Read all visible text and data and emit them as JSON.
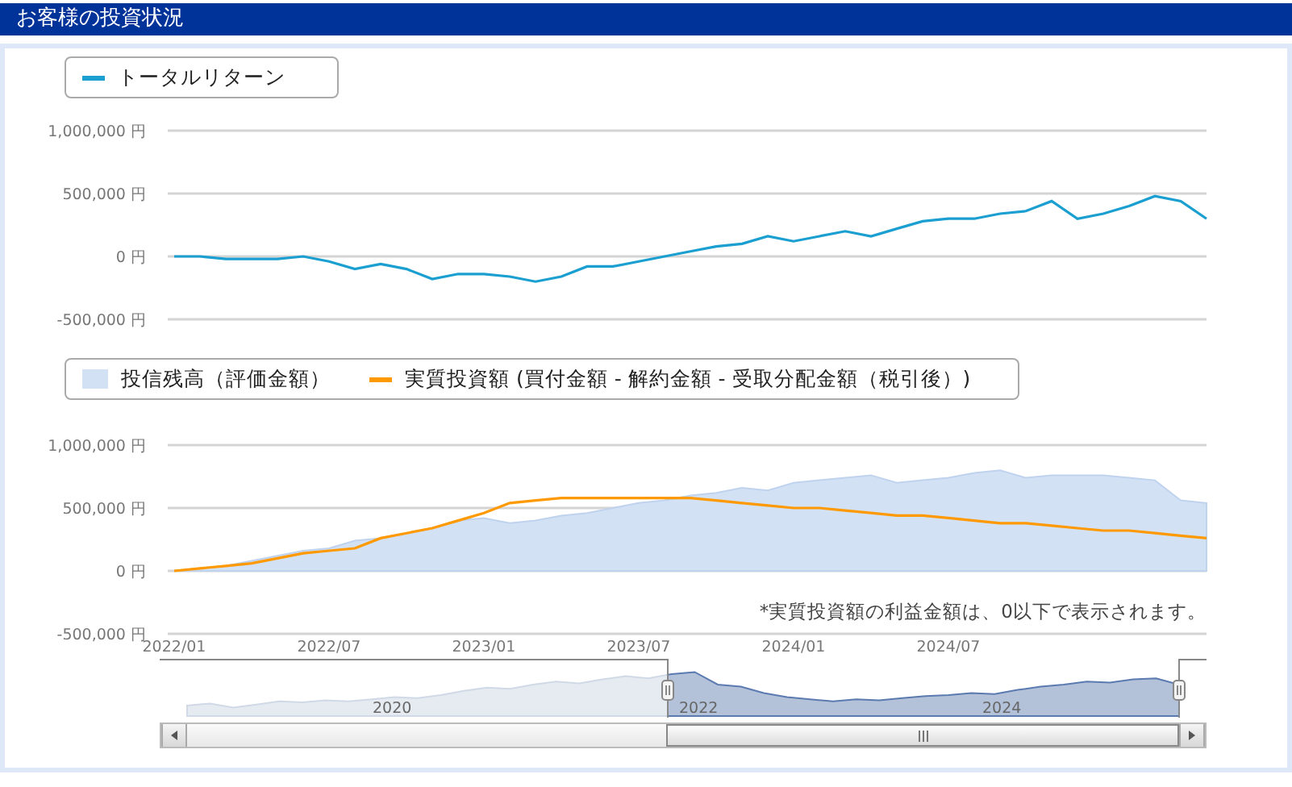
{
  "header": {
    "title": "お客様の投資状況"
  },
  "return_chart": {
    "chart_data": {
      "type": "line",
      "ylim": [
        -500000,
        1000000
      ],
      "yticks": [
        {
          "value": 1000000,
          "label": "1,000,000 円"
        },
        {
          "value": 500000,
          "label": "500,000 円"
        },
        {
          "value": 0,
          "label": "0 円"
        },
        {
          "value": -500000,
          "label": "-500,000 円"
        }
      ],
      "series": [
        {
          "name": "トータルリターン",
          "color": "#1a9fd0",
          "values": [
            0,
            0,
            -20000,
            -20000,
            -20000,
            0,
            -40000,
            -100000,
            -60000,
            -100000,
            -180000,
            -140000,
            -140000,
            -160000,
            -200000,
            -160000,
            -80000,
            -80000,
            -40000,
            0,
            40000,
            80000,
            100000,
            160000,
            120000,
            160000,
            200000,
            160000,
            220000,
            280000,
            300000,
            300000,
            340000,
            360000,
            440000,
            300000,
            340000,
            400000,
            480000,
            440000,
            300000
          ]
        }
      ]
    }
  },
  "balance_chart": {
    "chart_data": {
      "type": "area",
      "categories": [
        "2022/01",
        null,
        null,
        null,
        null,
        null,
        "2022/07",
        null,
        null,
        null,
        null,
        null,
        "2023/01",
        null,
        null,
        null,
        null,
        null,
        "2023/07",
        null,
        null,
        null,
        null,
        null,
        "2024/01",
        null,
        null,
        null,
        null,
        null,
        "2024/07",
        null,
        null,
        null,
        null,
        null,
        null,
        null,
        null,
        null,
        null
      ],
      "ylim": [
        -500000,
        1000000
      ],
      "yticks": [
        {
          "value": 1000000,
          "label": "1,000,000 円"
        },
        {
          "value": 500000,
          "label": "500,000 円"
        },
        {
          "value": 0,
          "label": "0 円"
        },
        {
          "value": -500000,
          "label": "-500,000 円"
        }
      ],
      "series": [
        {
          "name": "投信残高（評価金額）",
          "color": "#d3e1f5",
          "values": [
            0,
            20000,
            40000,
            80000,
            120000,
            160000,
            180000,
            240000,
            260000,
            300000,
            340000,
            400000,
            420000,
            380000,
            400000,
            440000,
            460000,
            500000,
            540000,
            560000,
            600000,
            620000,
            660000,
            640000,
            700000,
            720000,
            740000,
            760000,
            700000,
            720000,
            740000,
            780000,
            800000,
            740000,
            760000,
            760000,
            760000,
            740000,
            720000,
            560000,
            540000
          ]
        },
        {
          "name": "実質投資額 (買付金額 - 解約金額 - 受取分配金額（税引後）)",
          "type": "line",
          "color": "#ff9900",
          "values": [
            0,
            20000,
            40000,
            60000,
            100000,
            140000,
            160000,
            180000,
            260000,
            300000,
            340000,
            400000,
            460000,
            540000,
            560000,
            580000,
            580000,
            580000,
            580000,
            580000,
            580000,
            560000,
            540000,
            520000,
            500000,
            500000,
            480000,
            460000,
            440000,
            440000,
            420000,
            400000,
            380000,
            380000,
            360000,
            340000,
            320000,
            320000,
            300000,
            280000,
            260000
          ]
        }
      ]
    },
    "note": "*実質投資額の利益金額は、0以下で表示されます。"
  },
  "navigator": {
    "labels": [
      "2020",
      "2022",
      "2024"
    ]
  }
}
